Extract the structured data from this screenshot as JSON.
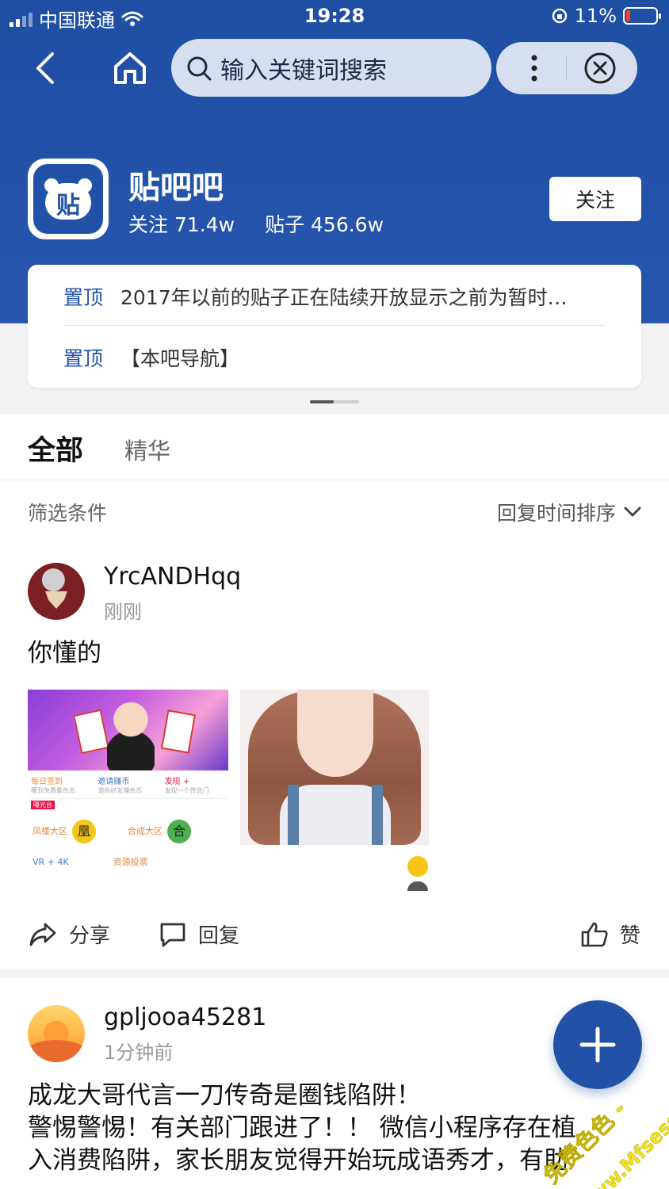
{
  "status_bar": {
    "carrier": "中国联通",
    "time": "19:28",
    "battery": "11%"
  },
  "nav": {
    "search_placeholder": "输入关键词搜索"
  },
  "forum": {
    "logo_glyph": "贴",
    "name": "贴吧吧",
    "follow_count": "关注 71.4w",
    "post_count": "贴子 456.6w",
    "follow_button": "关注"
  },
  "pinned": [
    {
      "tag": "置顶",
      "text": "2017年以前的贴子正在陆续开放显示之前为暂时…"
    },
    {
      "tag": "置顶",
      "text": "【本吧导航】"
    }
  ],
  "tabs": {
    "all": "全部",
    "best": "精华"
  },
  "filter": {
    "label": "筛选条件",
    "sort": "回复时间排序"
  },
  "posts": [
    {
      "username": "YrcANDHqq",
      "time": "刚刚",
      "text": "你懂的",
      "image1": {
        "cells": [
          {
            "title": "每日签到",
            "sub": "獲到免費拿色币"
          },
          {
            "title": "邀请赚币",
            "sub": "邀你好友赚色币"
          },
          {
            "title": "发现 +",
            "sub": "发现一个传送门"
          }
        ],
        "notice_tag": "曝光台",
        "row2": [
          {
            "label": "凤楼大区",
            "coin": "凰"
          },
          {
            "label": "合成大区",
            "coin": "合"
          }
        ],
        "row3": [
          "VR + 4K",
          "资源投票"
        ]
      },
      "actions": {
        "share": "分享",
        "reply": "回复",
        "like": "赞"
      }
    },
    {
      "username": "gpljooa45281",
      "time": "1分钟前",
      "text_lines": [
        "成龙大哥代言一刀传奇是圈钱陷阱！",
        "警惕警惕！有关部门跟进了！！ 微信小程序存在植",
        "入消费陷阱，家长朋友觉得开始玩成语秀才，有助"
      ]
    }
  ],
  "watermark": {
    "line1": "免费色色 -",
    "line2": "www.Mfsese.com"
  },
  "colors": {
    "header_blue": "#2152a8",
    "link_blue": "#2152a8",
    "background_gray": "#f3f3f5"
  }
}
